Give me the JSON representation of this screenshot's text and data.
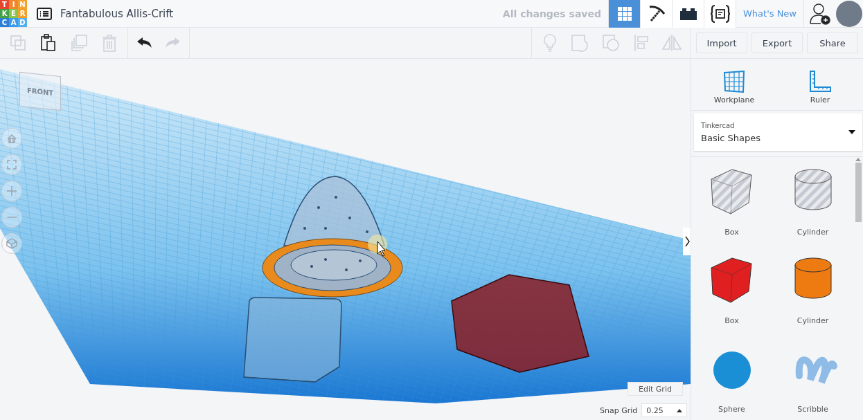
{
  "header": {
    "logo_letters": [
      "T",
      "I",
      "N",
      "K",
      "E",
      "R",
      "C",
      "A",
      "D"
    ],
    "design_title": "Fantabulous Allis-Crift",
    "save_status": "All changes saved",
    "nav": [
      {
        "kind": "grid",
        "selected": true
      },
      {
        "kind": "pickaxe",
        "selected": false
      },
      {
        "kind": "brick",
        "selected": false
      },
      {
        "kind": "codeblocks",
        "selected": false
      }
    ],
    "whats_new": "What's New"
  },
  "toolbar": {
    "edit_tools": [
      {
        "kind": "copy",
        "disabled": true
      },
      {
        "kind": "paste",
        "disabled": false
      },
      {
        "kind": "duplicate",
        "disabled": true
      },
      {
        "kind": "delete",
        "disabled": true
      }
    ],
    "history_tools": [
      {
        "kind": "undo",
        "disabled": false
      },
      {
        "kind": "redo",
        "disabled": true
      }
    ],
    "view_tools": [
      {
        "kind": "bulb",
        "disabled": true
      },
      {
        "kind": "note",
        "disabled": true
      },
      {
        "kind": "shape",
        "disabled": true
      },
      {
        "kind": "align",
        "disabled": true
      },
      {
        "kind": "mirror",
        "disabled": true
      }
    ],
    "buttons": [
      "Import",
      "Export",
      "Share"
    ]
  },
  "viewport": {
    "view_cube_label": "FRONT",
    "nav_controls": [
      {
        "kind": "home"
      },
      {
        "kind": "fit"
      },
      {
        "kind": "zoom-in"
      },
      {
        "kind": "zoom-out"
      },
      {
        "kind": "view"
      }
    ],
    "edit_grid": "Edit Grid",
    "snap_grid_label": "Snap Grid",
    "snap_grid_value": "0.25"
  },
  "sidebar": {
    "tools": [
      {
        "kind": "workplane",
        "label": "Workplane"
      },
      {
        "kind": "ruler",
        "label": "Ruler"
      }
    ],
    "library": {
      "source": "Tinkercad",
      "category": "Basic Shapes"
    },
    "shapes": [
      {
        "kind": "box",
        "name": "Box",
        "hole": true,
        "color": "#c5c9d1"
      },
      {
        "kind": "cylinder",
        "name": "Cylinder",
        "hole": true,
        "color": "#c5c9d1"
      },
      {
        "kind": "box",
        "name": "Box",
        "hole": false,
        "color": "#e02020"
      },
      {
        "kind": "cylinder",
        "name": "Cylinder",
        "hole": false,
        "color": "#ee7a12"
      },
      {
        "kind": "sphere",
        "name": "Sphere",
        "hole": false,
        "color": "#1a8fd6"
      },
      {
        "kind": "scribble",
        "name": "Scribble",
        "hole": false,
        "color": "#8ebce6"
      }
    ]
  }
}
